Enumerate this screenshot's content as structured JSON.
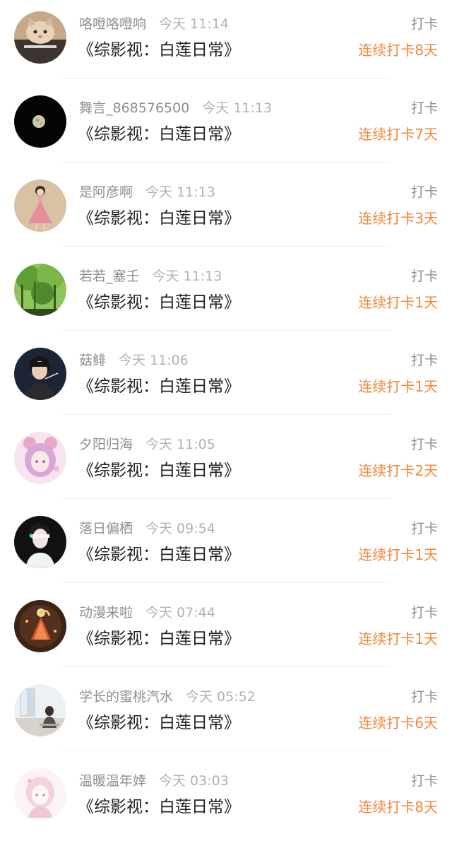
{
  "accent_color": "#f0873a",
  "entries": [
    {
      "username": "咯噔咯噔响",
      "time": "今天 11:14",
      "book": "《综影视：白莲日常》",
      "action": "打卡",
      "streak": "连续打卡8天",
      "avatar": "cat-photo"
    },
    {
      "username": "舞言_868576500",
      "time": "今天 11:13",
      "book": "《综影视：白莲日常》",
      "action": "打卡",
      "streak": "连续打卡7天",
      "avatar": "moon-photo"
    },
    {
      "username": "是阿彦啊",
      "time": "今天 11:13",
      "book": "《综影视：白莲日常》",
      "action": "打卡",
      "streak": "连续打卡3天",
      "avatar": "girl-in-dress"
    },
    {
      "username": "若若_塞壬",
      "time": "今天 11:13",
      "book": "《综影视：白莲日常》",
      "action": "打卡",
      "streak": "连续打卡1天",
      "avatar": "forest-photo"
    },
    {
      "username": "菇鲱",
      "time": "今天 11:06",
      "book": "《综影视：白莲日常》",
      "action": "打卡",
      "streak": "连续打卡1天",
      "avatar": "boy-portrait"
    },
    {
      "username": "夕阳归海",
      "time": "今天 11:05",
      "book": "《综影视：白莲日常》",
      "action": "打卡",
      "streak": "连续打卡2天",
      "avatar": "anime-girl-pink"
    },
    {
      "username": "落日偏栖",
      "time": "今天 09:54",
      "book": "《综影视：白莲日常》",
      "action": "打卡",
      "streak": "连续打卡1天",
      "avatar": "masked-boy"
    },
    {
      "username": "动漫来啦",
      "time": "今天 07:44",
      "book": "《综影视：白莲日常》",
      "action": "打卡",
      "streak": "连续打卡1天",
      "avatar": "anime-dancer-dark"
    },
    {
      "username": "学长的蜜桃汽水",
      "time": "今天 05:52",
      "book": "《综影视：白莲日常》",
      "action": "打卡",
      "streak": "连续打卡6天",
      "avatar": "room-photo"
    },
    {
      "username": "温暖温年婞",
      "time": "今天 03:03",
      "book": "《综影视：白莲日常》",
      "action": "打卡",
      "streak": "连续打卡8天",
      "avatar": "anime-girl-sketch"
    }
  ]
}
